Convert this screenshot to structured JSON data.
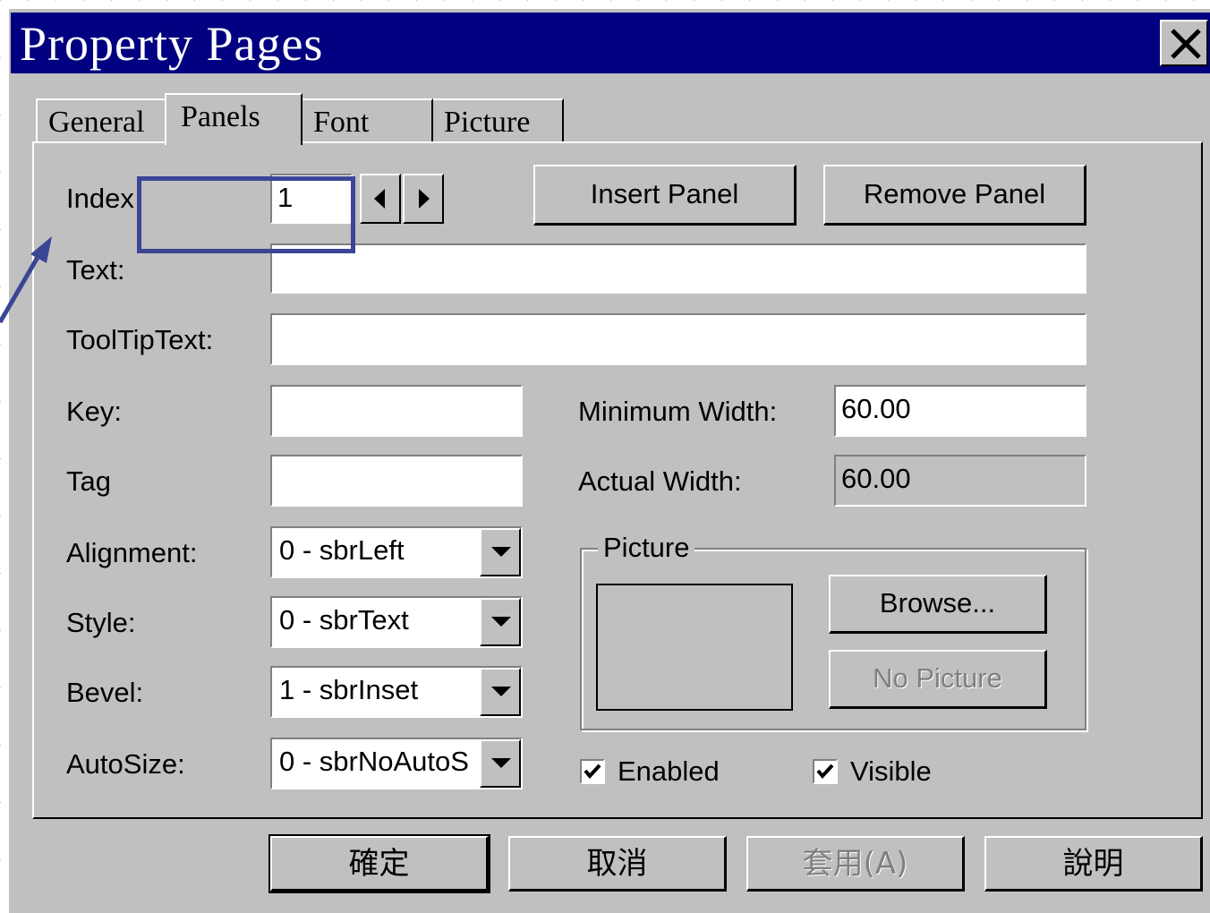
{
  "window": {
    "title": "Property Pages"
  },
  "tabs": [
    {
      "label": "General"
    },
    {
      "label": "Panels"
    },
    {
      "label": "Font"
    },
    {
      "label": "Picture"
    }
  ],
  "panels_tab": {
    "index_label": "Index",
    "index_value": "1",
    "insert_panel_label": "Insert Panel",
    "remove_panel_label": "Remove Panel",
    "text_label": "Text:",
    "text_value": "",
    "tooltip_label": "ToolTipText:",
    "tooltip_value": "",
    "key_label": "Key:",
    "key_value": "",
    "tag_label": "Tag",
    "tag_value": "",
    "min_width_label": "Minimum Width:",
    "min_width_value": "60.00",
    "actual_width_label": "Actual Width:",
    "actual_width_value": "60.00",
    "alignment_label": "Alignment:",
    "alignment_value": "0 - sbrLeft",
    "style_label": "Style:",
    "style_value": "0 - sbrText",
    "bevel_label": "Bevel:",
    "bevel_value": "1 - sbrInset",
    "autosize_label": "AutoSize:",
    "autosize_value": "0 - sbrNoAutoS",
    "picture_group_label": "Picture",
    "browse_label": "Browse...",
    "no_picture_label": "No Picture",
    "enabled_label": "Enabled",
    "enabled_checked": true,
    "visible_label": "Visible",
    "visible_checked": true
  },
  "footer": {
    "ok_label": "確定",
    "cancel_label": "取消",
    "apply_label": "套用(A)",
    "help_label": "說明"
  },
  "annotation": {
    "color": "#3b4595"
  }
}
